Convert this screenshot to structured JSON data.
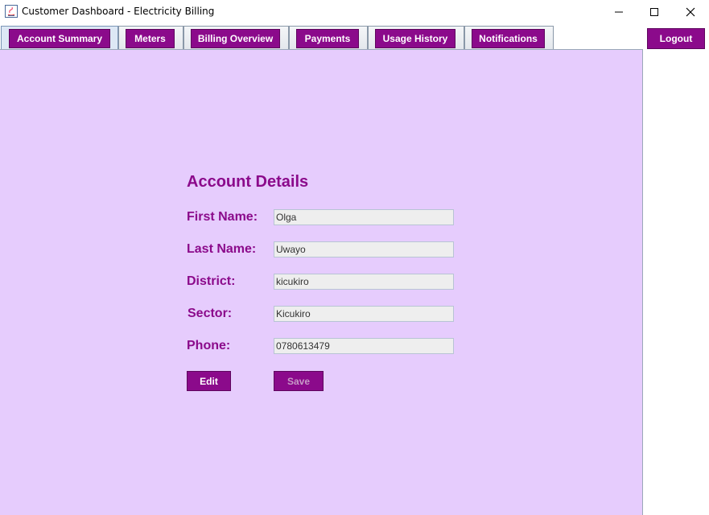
{
  "window": {
    "title": "Customer Dashboard - Electricity Billing"
  },
  "tabs": [
    {
      "label": "Account Summary",
      "active": true
    },
    {
      "label": "Meters",
      "active": false
    },
    {
      "label": "Billing Overview",
      "active": false
    },
    {
      "label": "Payments",
      "active": false
    },
    {
      "label": "Usage History",
      "active": false
    },
    {
      "label": "Notifications",
      "active": false
    }
  ],
  "logout_label": "Logout",
  "account": {
    "heading": "Account Details",
    "fields": [
      {
        "label": "First Name:",
        "value": "Olga"
      },
      {
        "label": "Last Name:",
        "value": "Uwayo"
      },
      {
        "label": "District:",
        "value": "kicukiro"
      },
      {
        "label": "Sector:",
        "value": "Kicukiro"
      },
      {
        "label": "Phone:",
        "value": "0780613479"
      }
    ],
    "edit_label": "Edit",
    "save_label": "Save"
  },
  "colors": {
    "accent": "#8b0a8b",
    "panel_bg": "#e6ccfd"
  }
}
